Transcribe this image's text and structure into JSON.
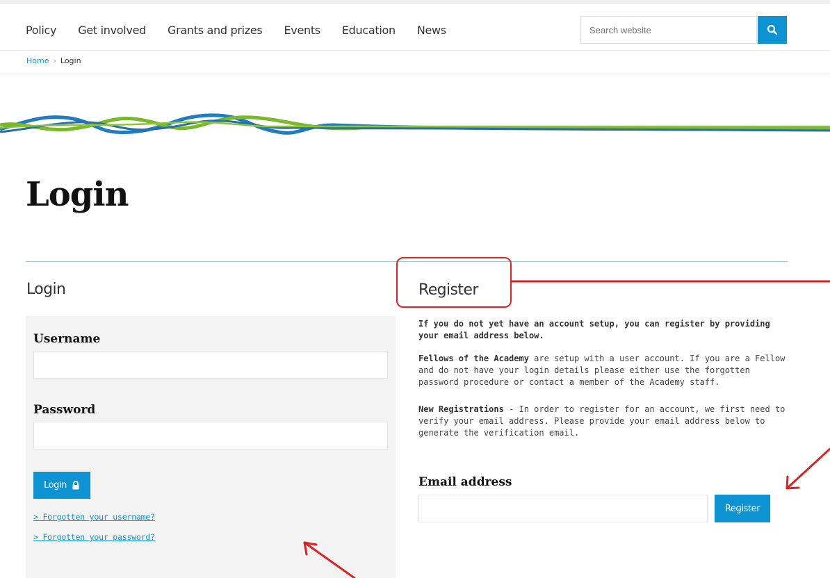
{
  "nav": {
    "items": [
      "Policy",
      "Get involved",
      "Grants and prizes",
      "Events",
      "Education",
      "News"
    ]
  },
  "search": {
    "placeholder": "Search website"
  },
  "breadcrumb": {
    "home": "Home",
    "separator": "›",
    "current": "Login"
  },
  "page": {
    "title": "Login"
  },
  "login": {
    "heading": "Login",
    "username_label": "Username",
    "password_label": "Password",
    "button_label": "Login",
    "forgot_username": "> Forgotten your username?",
    "forgot_password": "> Forgotten your password?"
  },
  "register": {
    "heading": "Register",
    "intro": "If you do not yet have an account setup, you can register by providing your email address below.",
    "fellows_bold": "Fellows of the Academy",
    "fellows_text": " are setup with a user account. If you are a Fellow and do not have your login details please either use the forgotten password procedure or contact a member of the Academy staff.",
    "new_bold": "New Registrations",
    "new_text": " - In order to register for an account, we first need to verify your email address. Please provide your email address below to generate the verification email.",
    "email_label": "Email address",
    "button_label": "Register"
  },
  "colors": {
    "accent": "#0d93d2",
    "annotation": "#e02020",
    "wave_green": "#7ab929",
    "wave_blue": "#1f7cc0"
  },
  "icons": {
    "search": "search-icon",
    "lock": "lock-icon"
  }
}
